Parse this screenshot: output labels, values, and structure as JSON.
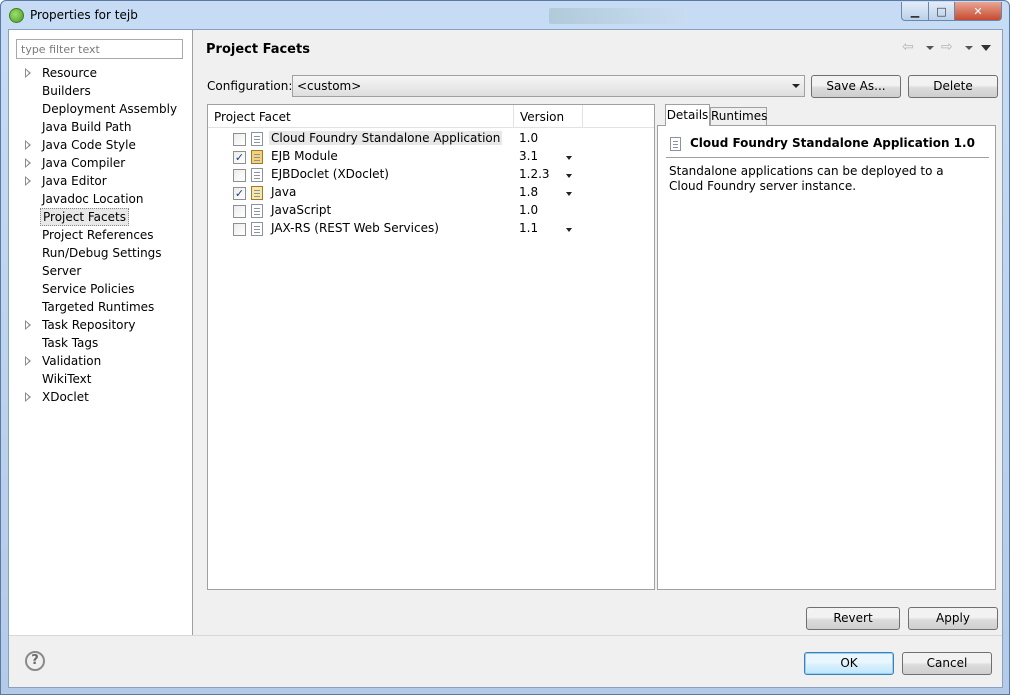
{
  "window": {
    "title": "Properties for tejb",
    "controls": {
      "minimize": "▁",
      "maximize": "□",
      "close": "✕"
    }
  },
  "sidebar": {
    "filter_placeholder": "type filter text",
    "items": [
      {
        "label": "Resource",
        "expandable": true,
        "selected": false
      },
      {
        "label": "Builders",
        "expandable": false,
        "selected": false
      },
      {
        "label": "Deployment Assembly",
        "expandable": false,
        "selected": false
      },
      {
        "label": "Java Build Path",
        "expandable": false,
        "selected": false
      },
      {
        "label": "Java Code Style",
        "expandable": true,
        "selected": false
      },
      {
        "label": "Java Compiler",
        "expandable": true,
        "selected": false
      },
      {
        "label": "Java Editor",
        "expandable": true,
        "selected": false
      },
      {
        "label": "Javadoc Location",
        "expandable": false,
        "selected": false
      },
      {
        "label": "Project Facets",
        "expandable": false,
        "selected": true
      },
      {
        "label": "Project References",
        "expandable": false,
        "selected": false
      },
      {
        "label": "Run/Debug Settings",
        "expandable": false,
        "selected": false
      },
      {
        "label": "Server",
        "expandable": false,
        "selected": false
      },
      {
        "label": "Service Policies",
        "expandable": false,
        "selected": false
      },
      {
        "label": "Targeted Runtimes",
        "expandable": false,
        "selected": false
      },
      {
        "label": "Task Repository",
        "expandable": true,
        "selected": false
      },
      {
        "label": "Task Tags",
        "expandable": false,
        "selected": false
      },
      {
        "label": "Validation",
        "expandable": true,
        "selected": false
      },
      {
        "label": "WikiText",
        "expandable": false,
        "selected": false
      },
      {
        "label": "XDoclet",
        "expandable": true,
        "selected": false
      }
    ]
  },
  "main": {
    "title": "Project Facets",
    "nav": {
      "back": "⇦",
      "forward": "⇨"
    },
    "configuration": {
      "label": "Configuration:",
      "value": "<custom>",
      "save_as": "Save As...",
      "delete": "Delete"
    },
    "facet_table": {
      "columns": [
        "Project Facet",
        "Version"
      ],
      "rows": [
        {
          "name": "Cloud Foundry Standalone Application",
          "version": "1.0",
          "checked": false,
          "has_dropdown": false,
          "icon": "page",
          "highlight": true
        },
        {
          "name": "EJB Module",
          "version": "3.1",
          "checked": true,
          "has_dropdown": true,
          "icon": "ejb",
          "highlight": false
        },
        {
          "name": "EJBDoclet (XDoclet)",
          "version": "1.2.3",
          "checked": false,
          "has_dropdown": true,
          "icon": "page",
          "highlight": false
        },
        {
          "name": "Java",
          "version": "1.8",
          "checked": true,
          "has_dropdown": true,
          "icon": "java",
          "highlight": false
        },
        {
          "name": "JavaScript",
          "version": "1.0",
          "checked": false,
          "has_dropdown": false,
          "icon": "page",
          "highlight": false
        },
        {
          "name": "JAX-RS (REST Web Services)",
          "version": "1.1",
          "checked": false,
          "has_dropdown": true,
          "icon": "page",
          "highlight": false
        }
      ]
    },
    "tabs": {
      "details": "Details",
      "runtimes": "Runtimes",
      "active": "details"
    },
    "details": {
      "title": "Cloud Foundry Standalone Application 1.0",
      "description": "Standalone applications can be deployed to a Cloud Foundry server instance."
    },
    "revert": "Revert",
    "apply": "Apply"
  },
  "footer": {
    "help": "?",
    "ok": "OK",
    "cancel": "Cancel"
  }
}
